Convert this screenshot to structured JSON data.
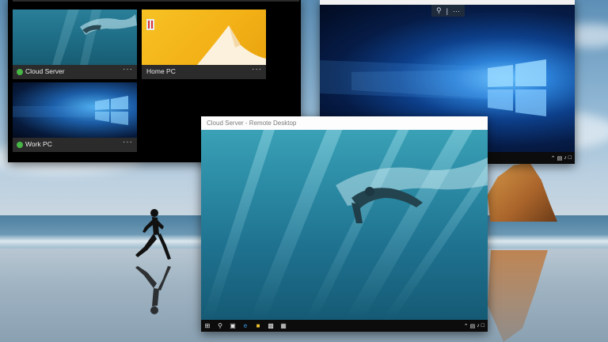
{
  "launcher": {
    "tiles": [
      {
        "label": "Cloud Server",
        "status_color": "#47b847",
        "thumbnail": "underwater-swimmer",
        "more": "···"
      },
      {
        "label": "Home PC",
        "status_color": null,
        "thumbnail": "windows8-yellow",
        "more": "···"
      },
      {
        "label": "Work PC",
        "status_color": "#47b847",
        "thumbnail": "windows10-hero",
        "more": "···"
      }
    ]
  },
  "session_toolbar": {
    "zoom_icon": "zoom-icon",
    "separator": "|",
    "more": "···"
  },
  "remote_window": {
    "title": "Cloud Server - Remote Desktop"
  },
  "taskbar": {
    "start_icon": "windows-logo-icon",
    "search_icon": "search-icon",
    "task_view_icon": "task-view-icon",
    "edge_icon": "edge-browser-icon",
    "explorer_icon": "file-explorer-icon",
    "tray_icons": [
      "chevron-up-icon",
      "network-icon",
      "volume-icon",
      "notification-icon"
    ]
  },
  "colors": {
    "status_online": "#47b847",
    "taskbar": "#0c0c0c",
    "launcher_bg": "#000000"
  }
}
